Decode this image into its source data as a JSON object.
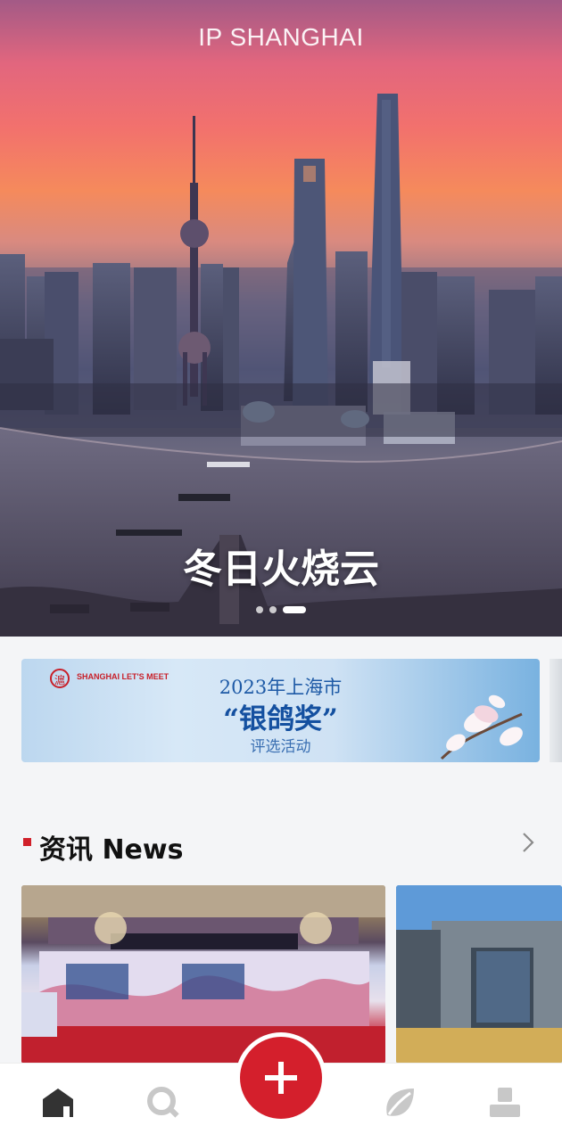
{
  "app": {
    "title": "IP SHANGHAI"
  },
  "hero": {
    "caption": "冬日火烧云",
    "dots_total": 3,
    "active_dot": 3
  },
  "banner": {
    "logo_text": "SHANGHAI LET'S MEET",
    "year_line": "2023年上海市",
    "award_line": "“银鸽奖”",
    "sub_line": "评选活动"
  },
  "news_section": {
    "title": "资讯 News",
    "more_icon": "chevron-right-icon"
  },
  "bottom_nav": {
    "items": [
      {
        "icon": "home-icon",
        "active": true
      },
      {
        "icon": "search-icon",
        "active": false
      },
      {
        "icon": "plus-icon",
        "active": false
      },
      {
        "icon": "leaf-icon",
        "active": false
      },
      {
        "icon": "profile-icon",
        "active": false
      }
    ]
  },
  "colors": {
    "accent": "#d41f2c",
    "nav_active": "#333333",
    "nav_inactive": "#c8c8c8"
  }
}
